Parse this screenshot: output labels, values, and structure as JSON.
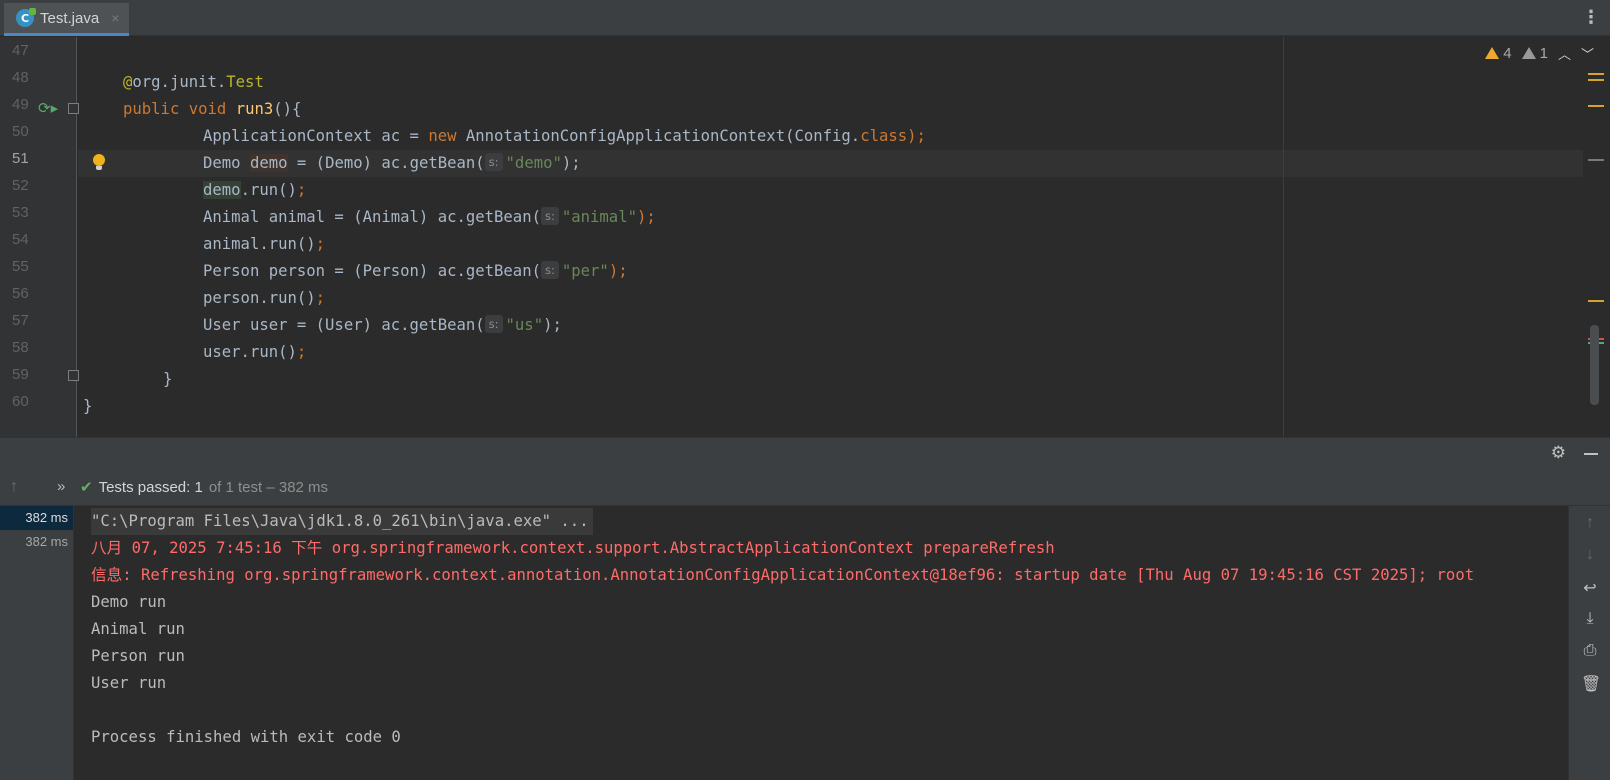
{
  "tab": {
    "icon_letter": "C",
    "label": "Test.java",
    "close": "×"
  },
  "editor": {
    "line_numbers": [
      "47",
      "48",
      "49",
      "50",
      "51",
      "52",
      "53",
      "54",
      "55",
      "56",
      "57",
      "58",
      "59",
      "60"
    ],
    "current_line": "51",
    "inspections": {
      "warnings": "4",
      "weak_warnings": "1"
    },
    "lines": {
      "l48": {
        "ann_at": "@",
        "ann_pkg": "org.junit.",
        "ann_name": "Test"
      },
      "l49": {
        "kw1": "public",
        "kw2": "void",
        "method": "run3",
        "rest": "(){"
      },
      "l50": {
        "pre": "ApplicationContext ac = ",
        "kw": "new",
        "mid": " AnnotationConfigApplicationContext(Config.",
        "kw2": "class",
        "post": ");"
      },
      "l51": {
        "type": "Demo ",
        "var": "demo",
        "mid": " = (Demo) ac.getBean(",
        "hint": "s:",
        "str": "\"demo\"",
        "end": ");"
      },
      "l52": {
        "var": "demo",
        "rest": ".run()",
        "semi": ";"
      },
      "l53": {
        "pre": "Animal animal = (Animal) ac.getBean(",
        "hint": "s:",
        "str": "\"animal\"",
        "end": ");"
      },
      "l54": {
        "rest": "animal.run()",
        "semi": ";"
      },
      "l55": {
        "pre": "Person person = (Person) ac.getBean(",
        "hint": "s:",
        "str": "\"per\"",
        "end": ");"
      },
      "l56": {
        "rest": "person.run()",
        "semi": ";"
      },
      "l57": {
        "pre": "User user = (User) ac.getBean(",
        "hint": "s:",
        "str": "\"us\"",
        "end": ");"
      },
      "l58": {
        "rest": "user.run()",
        "semi": ";"
      },
      "l59": {
        "rest": "}"
      },
      "l60": {
        "rest": "}"
      }
    }
  },
  "test_status": {
    "passed_label": "Tests passed: 1",
    "detail": "of 1 test – 382 ms"
  },
  "tree": [
    {
      "label": "382 ms",
      "selected": true
    },
    {
      "label": "382 ms",
      "selected": false
    }
  ],
  "console": {
    "command": "\"C:\\Program Files\\Java\\jdk1.8.0_261\\bin\\java.exe\" ...",
    "log1": "八月 07, 2025 7:45:16 下午 org.springframework.context.support.AbstractApplicationContext prepareRefresh",
    "log2": "信息: Refreshing org.springframework.context.annotation.AnnotationConfigApplicationContext@18ef96: startup date [Thu Aug 07 19:45:16 CST 2025]; root",
    "out1": "Demo run",
    "out2": "Animal run",
    "out3": "Person run",
    "out4": "User run",
    "exit": "Process finished with exit code 0"
  },
  "colors": {
    "keyword": "#cc7832",
    "string": "#6a8759",
    "method": "#ffc66d",
    "annotation": "#bbb529",
    "error_output": "#ff6b68",
    "pass_check": "#5fb45b"
  }
}
